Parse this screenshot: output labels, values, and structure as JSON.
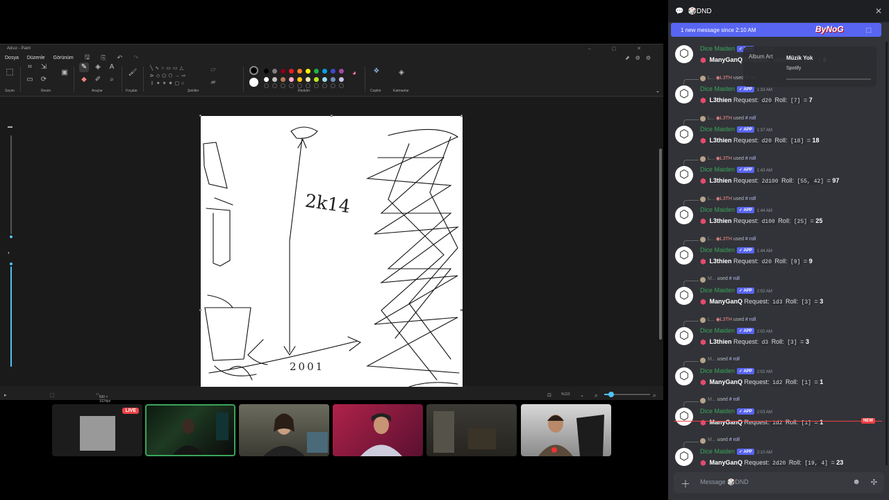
{
  "paint": {
    "title": "Adsız - Paint",
    "menu": [
      "Dosya",
      "Düzenle",
      "Görünüm"
    ],
    "groups": {
      "selection": "Seçim",
      "image": "Resim",
      "tools": "Araçlar",
      "brushes": "Fırçalar",
      "shapes": "Şekiller",
      "colors": "Renkler",
      "copilot": "Copilot",
      "layers": "Katmanlar"
    },
    "status": {
      "canvas_size": "690 × 1024px",
      "zoom": "%113"
    },
    "colors": {
      "row1": [
        "#000000",
        "#7f7f7f",
        "#880015",
        "#ed1c24",
        "#ff7f27",
        "#fff200",
        "#22b14c",
        "#00a2e8",
        "#3f48cc",
        "#a349a4"
      ],
      "row2": [
        "#ffffff",
        "#c3c3c3",
        "#b97a57",
        "#ffaec9",
        "#ffc90e",
        "#efe4b0",
        "#b5e61d",
        "#99d9ea",
        "#7092be",
        "#c8bfe7"
      ]
    },
    "canvas_drawing_text": [
      "2k14",
      "2001"
    ]
  },
  "stream": {
    "live_label": "LIVE"
  },
  "discord": {
    "channel": "DND",
    "banner": "1 new message since 2:10 AM",
    "overlay_text": "ByNoG",
    "now_playing": {
      "art_label": "Album Art",
      "title": "Müzik Yok",
      "source": "Spotify"
    },
    "composer_placeholder": "Message 🎲DND",
    "new_label": "NEW",
    "messages": [
      {
        "reply_user": "",
        "reply_tag": "",
        "reply_cmd": "",
        "bot": "Dice Maiden",
        "badge": "APP",
        "time": "12:38 AM",
        "user": "ManyGanQ",
        "request": "1d20",
        "roll": "[6]",
        "total": "6"
      },
      {
        "reply_user": "L...",
        "reply_tag": "L3TH",
        "reply_cmd": "roll",
        "bot": "Dice Maiden",
        "badge": "APP",
        "time": "1:33 AM",
        "user": "L3thien",
        "request": "d20",
        "roll": "[7]",
        "total": "7"
      },
      {
        "reply_user": "L...",
        "reply_tag": "L3TH",
        "reply_cmd": "roll",
        "bot": "Dice Maiden",
        "badge": "APP",
        "time": "1:37 AM",
        "user": "L3thien",
        "request": "d20",
        "roll": "[18]",
        "total": "18"
      },
      {
        "reply_user": "L...",
        "reply_tag": "L3TH",
        "reply_cmd": "roll",
        "bot": "Dice Maiden",
        "badge": "APP",
        "time": "1:43 AM",
        "user": "L3thien",
        "request": "2d100",
        "roll": "[55, 42]",
        "total": "97"
      },
      {
        "reply_user": "L...",
        "reply_tag": "L3TH",
        "reply_cmd": "roll",
        "bot": "Dice Maiden",
        "badge": "APP",
        "time": "1:44 AM",
        "user": "L3thien",
        "request": "d100",
        "roll": "[25]",
        "total": "25"
      },
      {
        "reply_user": "L...",
        "reply_tag": "L3TH",
        "reply_cmd": "roll",
        "bot": "Dice Maiden",
        "badge": "APP",
        "time": "1:44 AM",
        "user": "L3thien",
        "request": "d20",
        "roll": "[9]",
        "total": "9"
      },
      {
        "reply_user": "M...",
        "reply_tag": "",
        "reply_cmd": "roll",
        "bot": "Dice Maiden",
        "badge": "APP",
        "time": "2:02 AM",
        "user": "ManyGanQ",
        "request": "1d3",
        "roll": "[3]",
        "total": "3"
      },
      {
        "reply_user": "L...",
        "reply_tag": "L3TH",
        "reply_cmd": "roll",
        "bot": "Dice Maiden",
        "badge": "APP",
        "time": "2:02 AM",
        "user": "L3thien",
        "request": "d3",
        "roll": "[3]",
        "total": "3"
      },
      {
        "reply_user": "M...",
        "reply_tag": "",
        "reply_cmd": "roll",
        "bot": "Dice Maiden",
        "badge": "APP",
        "time": "2:02 AM",
        "user": "ManyGanQ",
        "request": "1d2",
        "roll": "[1]",
        "total": "1"
      },
      {
        "reply_user": "M...",
        "reply_tag": "",
        "reply_cmd": "roll",
        "bot": "Dice Maiden",
        "badge": "APP",
        "time": "2:03 AM",
        "user": "ManyGanQ",
        "request": "1d2",
        "roll": "[1]",
        "total": "1"
      },
      {
        "reply_user": "M...",
        "reply_tag": "",
        "reply_cmd": "roll",
        "bot": "Dice Maiden",
        "badge": "APP",
        "time": "2:10 AM",
        "user": "ManyGanQ",
        "request": "2d20",
        "roll": "[19, 4]",
        "total": "23"
      }
    ],
    "labels": {
      "used": "used",
      "request": "Request:",
      "roll": "Roll:",
      "equals": "=",
      "hash": "#"
    }
  }
}
